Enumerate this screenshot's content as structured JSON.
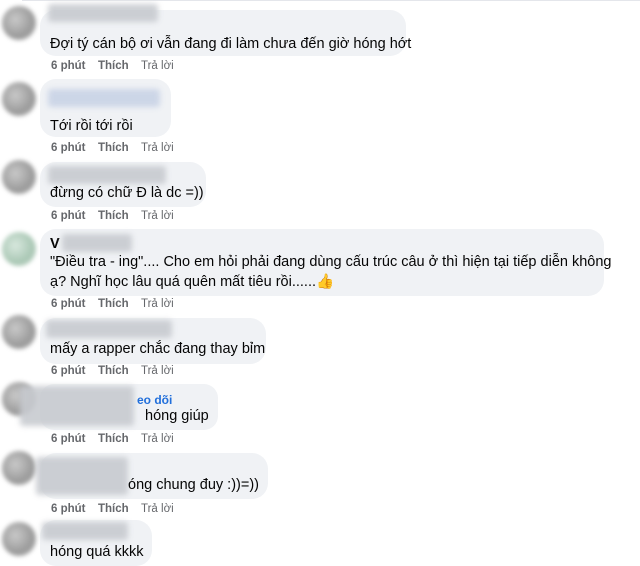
{
  "comments": [
    {
      "text": "Đợi tý cán bộ ơi vẫn đang đi làm chưa đến giờ hóng hớt",
      "time": "6 phút",
      "like": "Thích",
      "reply": "Trả lời"
    },
    {
      "text": "Tới rồi tới rồi",
      "time": "6 phút",
      "like": "Thích",
      "reply": "Trả lời"
    },
    {
      "text": "đừng có chữ Đ là dc =))",
      "time": "6 phút",
      "like": "Thích",
      "reply": "Trả lời"
    },
    {
      "name_partial": "V",
      "line1": "\"Điều tra - ing\".... Cho em hỏi phải đang dùng cấu trúc câu ở thì hiện tại tiếp diễn không",
      "line2": "ạ? Nghĩ học lâu quá quên mất tiêu rồi......👍",
      "time": "6 phút",
      "like": "Thích",
      "reply": "Trả lời"
    },
    {
      "text": "mấy a rapper chắc đang thay bỉm",
      "time": "6 phút",
      "like": "Thích",
      "reply": "Trả lời"
    },
    {
      "follow_partial": "eo dõi",
      "text": "hóng giúp",
      "time": "6 phút",
      "like": "Thích",
      "reply": "Trả lời"
    },
    {
      "text": "óng chung đuy :))=))",
      "time": "6 phút",
      "like": "Thích",
      "reply": "Trả lời"
    },
    {
      "text": "hóng quá kkkk"
    }
  ],
  "colors": {
    "bubble": "#f0f2f5",
    "meta": "#65676b",
    "link": "#216fdb"
  }
}
